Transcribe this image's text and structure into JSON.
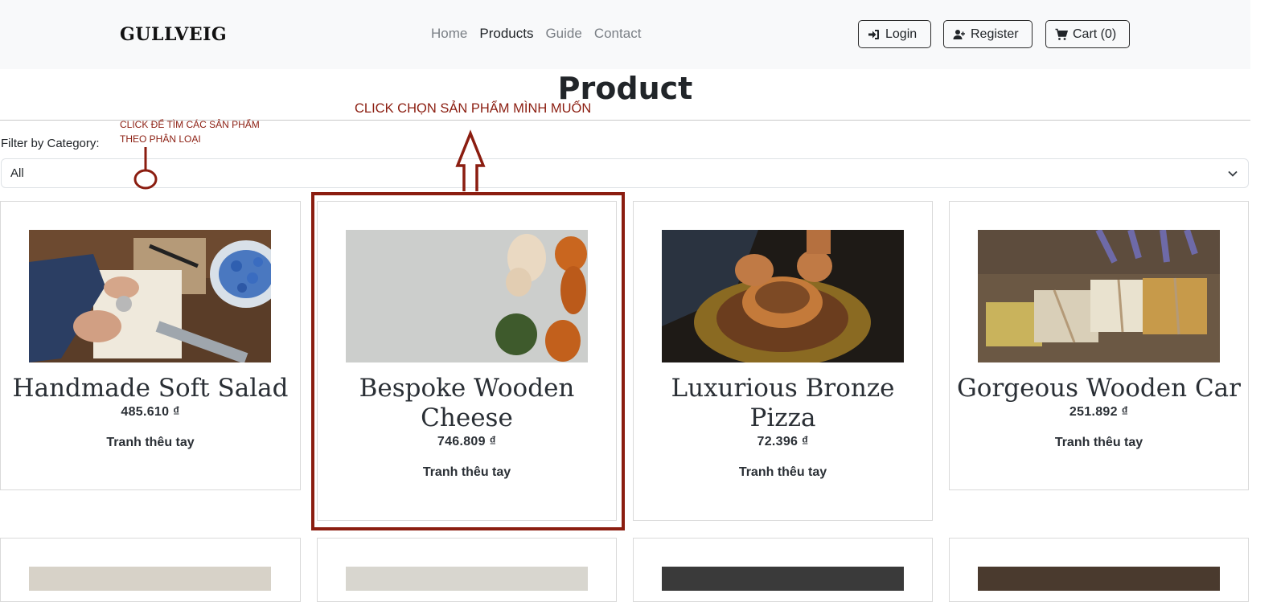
{
  "header": {
    "brand": "GULLVEIG",
    "nav": [
      "Home",
      "Products",
      "Guide",
      "Contact"
    ],
    "active_nav": "Products",
    "login_label": "Login",
    "register_label": "Register",
    "cart_label": "Cart (0)"
  },
  "page": {
    "title": "Product"
  },
  "annotations": {
    "select_product": "CLICK CHỌN SẢN PHẨM MÌNH MUỐN",
    "filter_hint_line1": "CLICK ĐỂ TÌM CÁC SẢN PHẨM",
    "filter_hint_line2": "THEO PHÂN LOẠI",
    "color": "#8b1d10"
  },
  "filter": {
    "label": "Filter by Category:",
    "selected": "All"
  },
  "products": [
    {
      "name": "Handmade Soft Salad",
      "price": "485.610 ₫",
      "category": "Tranh thêu tay",
      "image": "craft-workbench-photo"
    },
    {
      "name": "Bespoke Wooden Cheese",
      "price": "746.809 ₫",
      "category": "Tranh thêu tay",
      "image": "yarn-skeins-photo"
    },
    {
      "name": "Luxurious Bronze Pizza",
      "price": "72.396 ₫",
      "category": "Tranh thêu tay",
      "image": "pottery-wheel-photo"
    },
    {
      "name": "Gorgeous Wooden Car",
      "price": "251.892 ₫",
      "category": "Tranh thêu tay",
      "image": "handmade-soap-photo"
    }
  ]
}
